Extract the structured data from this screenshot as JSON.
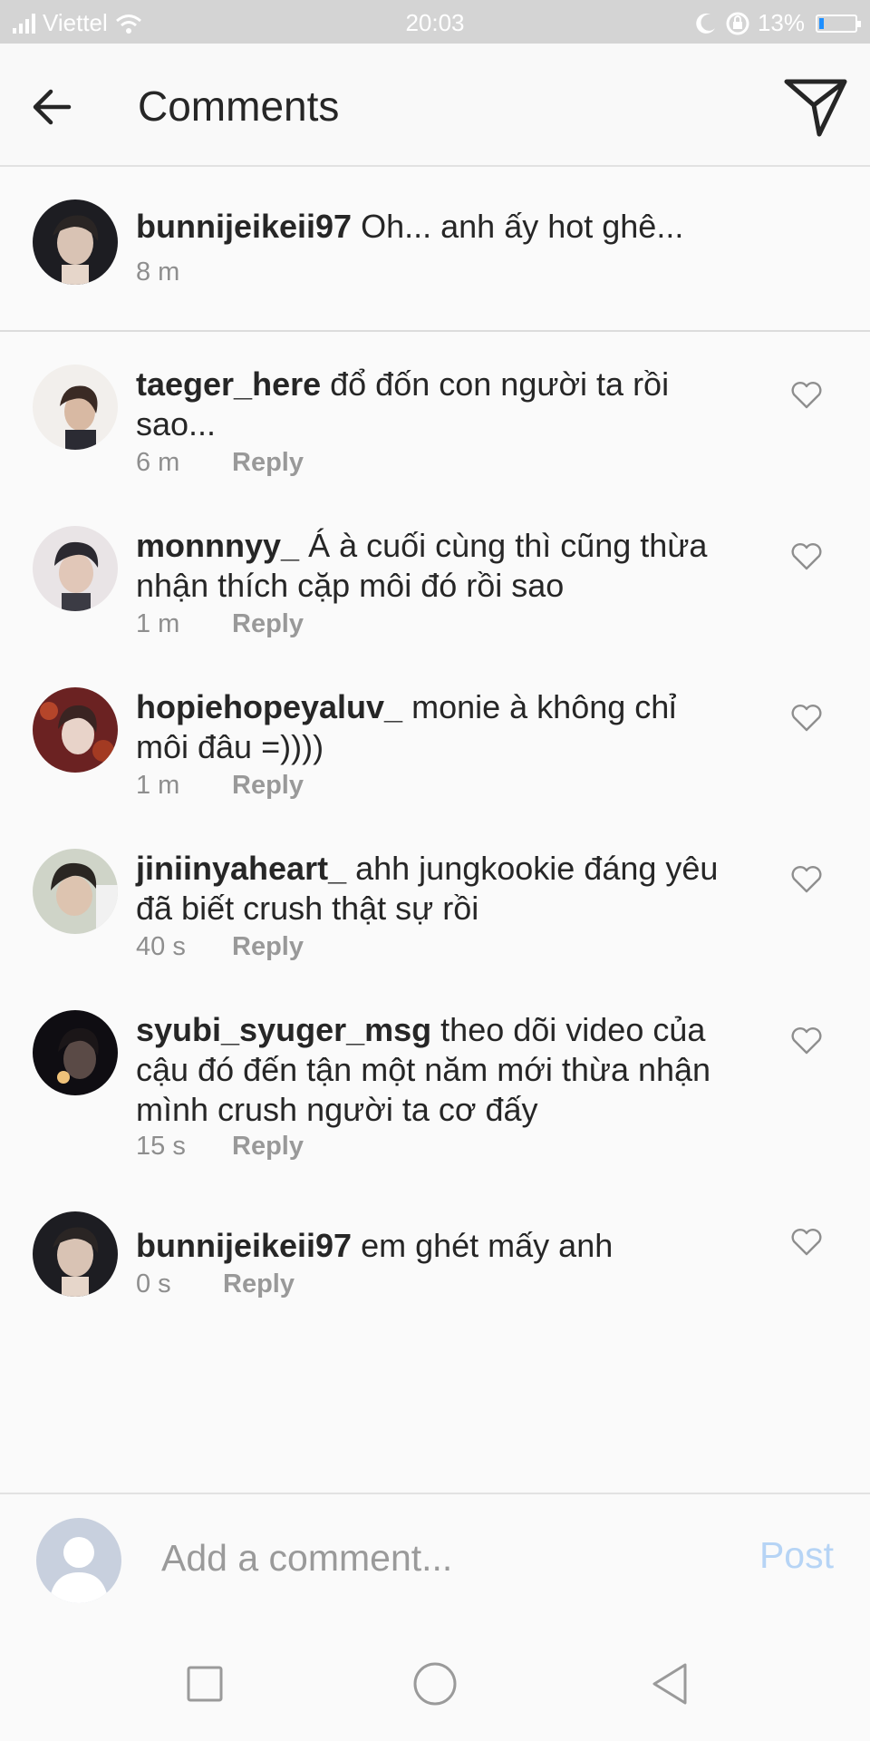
{
  "status_bar": {
    "carrier": "Viettel",
    "time": "20:03",
    "battery": "13%",
    "battery_level": 0.13
  },
  "header": {
    "title": "Comments",
    "back_icon": "arrow-left-icon",
    "share_icon": "paper-plane-icon"
  },
  "caption": {
    "username": "bunnijeikeii97",
    "text": "Oh... anh ấy hot ghê...",
    "time": "8 m"
  },
  "comments": [
    {
      "username": "taeger_here",
      "text": "đổ đốn con người ta rồi sao...",
      "time": "6 m",
      "reply": "Reply"
    },
    {
      "username": "monnnyy_",
      "text": "Á à cuối cùng thì cũng thừa nhận thích cặp môi đó rồi sao",
      "time": "1 m",
      "reply": "Reply"
    },
    {
      "username": "hopiehopeyaluv_",
      "text": "monie à không chỉ môi đâu =))))",
      "time": "1 m",
      "reply": "Reply"
    },
    {
      "username": "jiniinyaheart_",
      "text": "ahh jungkookie đáng yêu đã biết crush thật sự rồi",
      "time": "40 s",
      "reply": "Reply"
    },
    {
      "username": "syubi_syuger_msg",
      "text": "theo dõi video của cậu đó đến tận một năm mới thừa nhận mình crush người ta cơ đấy",
      "time": "15 s",
      "reply": "Reply"
    },
    {
      "username": "bunnijeikeii97",
      "text": "em ghét mấy anh",
      "time": "0 s",
      "reply": "Reply"
    }
  ],
  "composer": {
    "placeholder": "Add a comment...",
    "post_label": "Post"
  },
  "colors": {
    "link_blue": "#b6d4f5",
    "battery_blue": "#1e8fff",
    "meta_gray": "#8e8e8e"
  }
}
